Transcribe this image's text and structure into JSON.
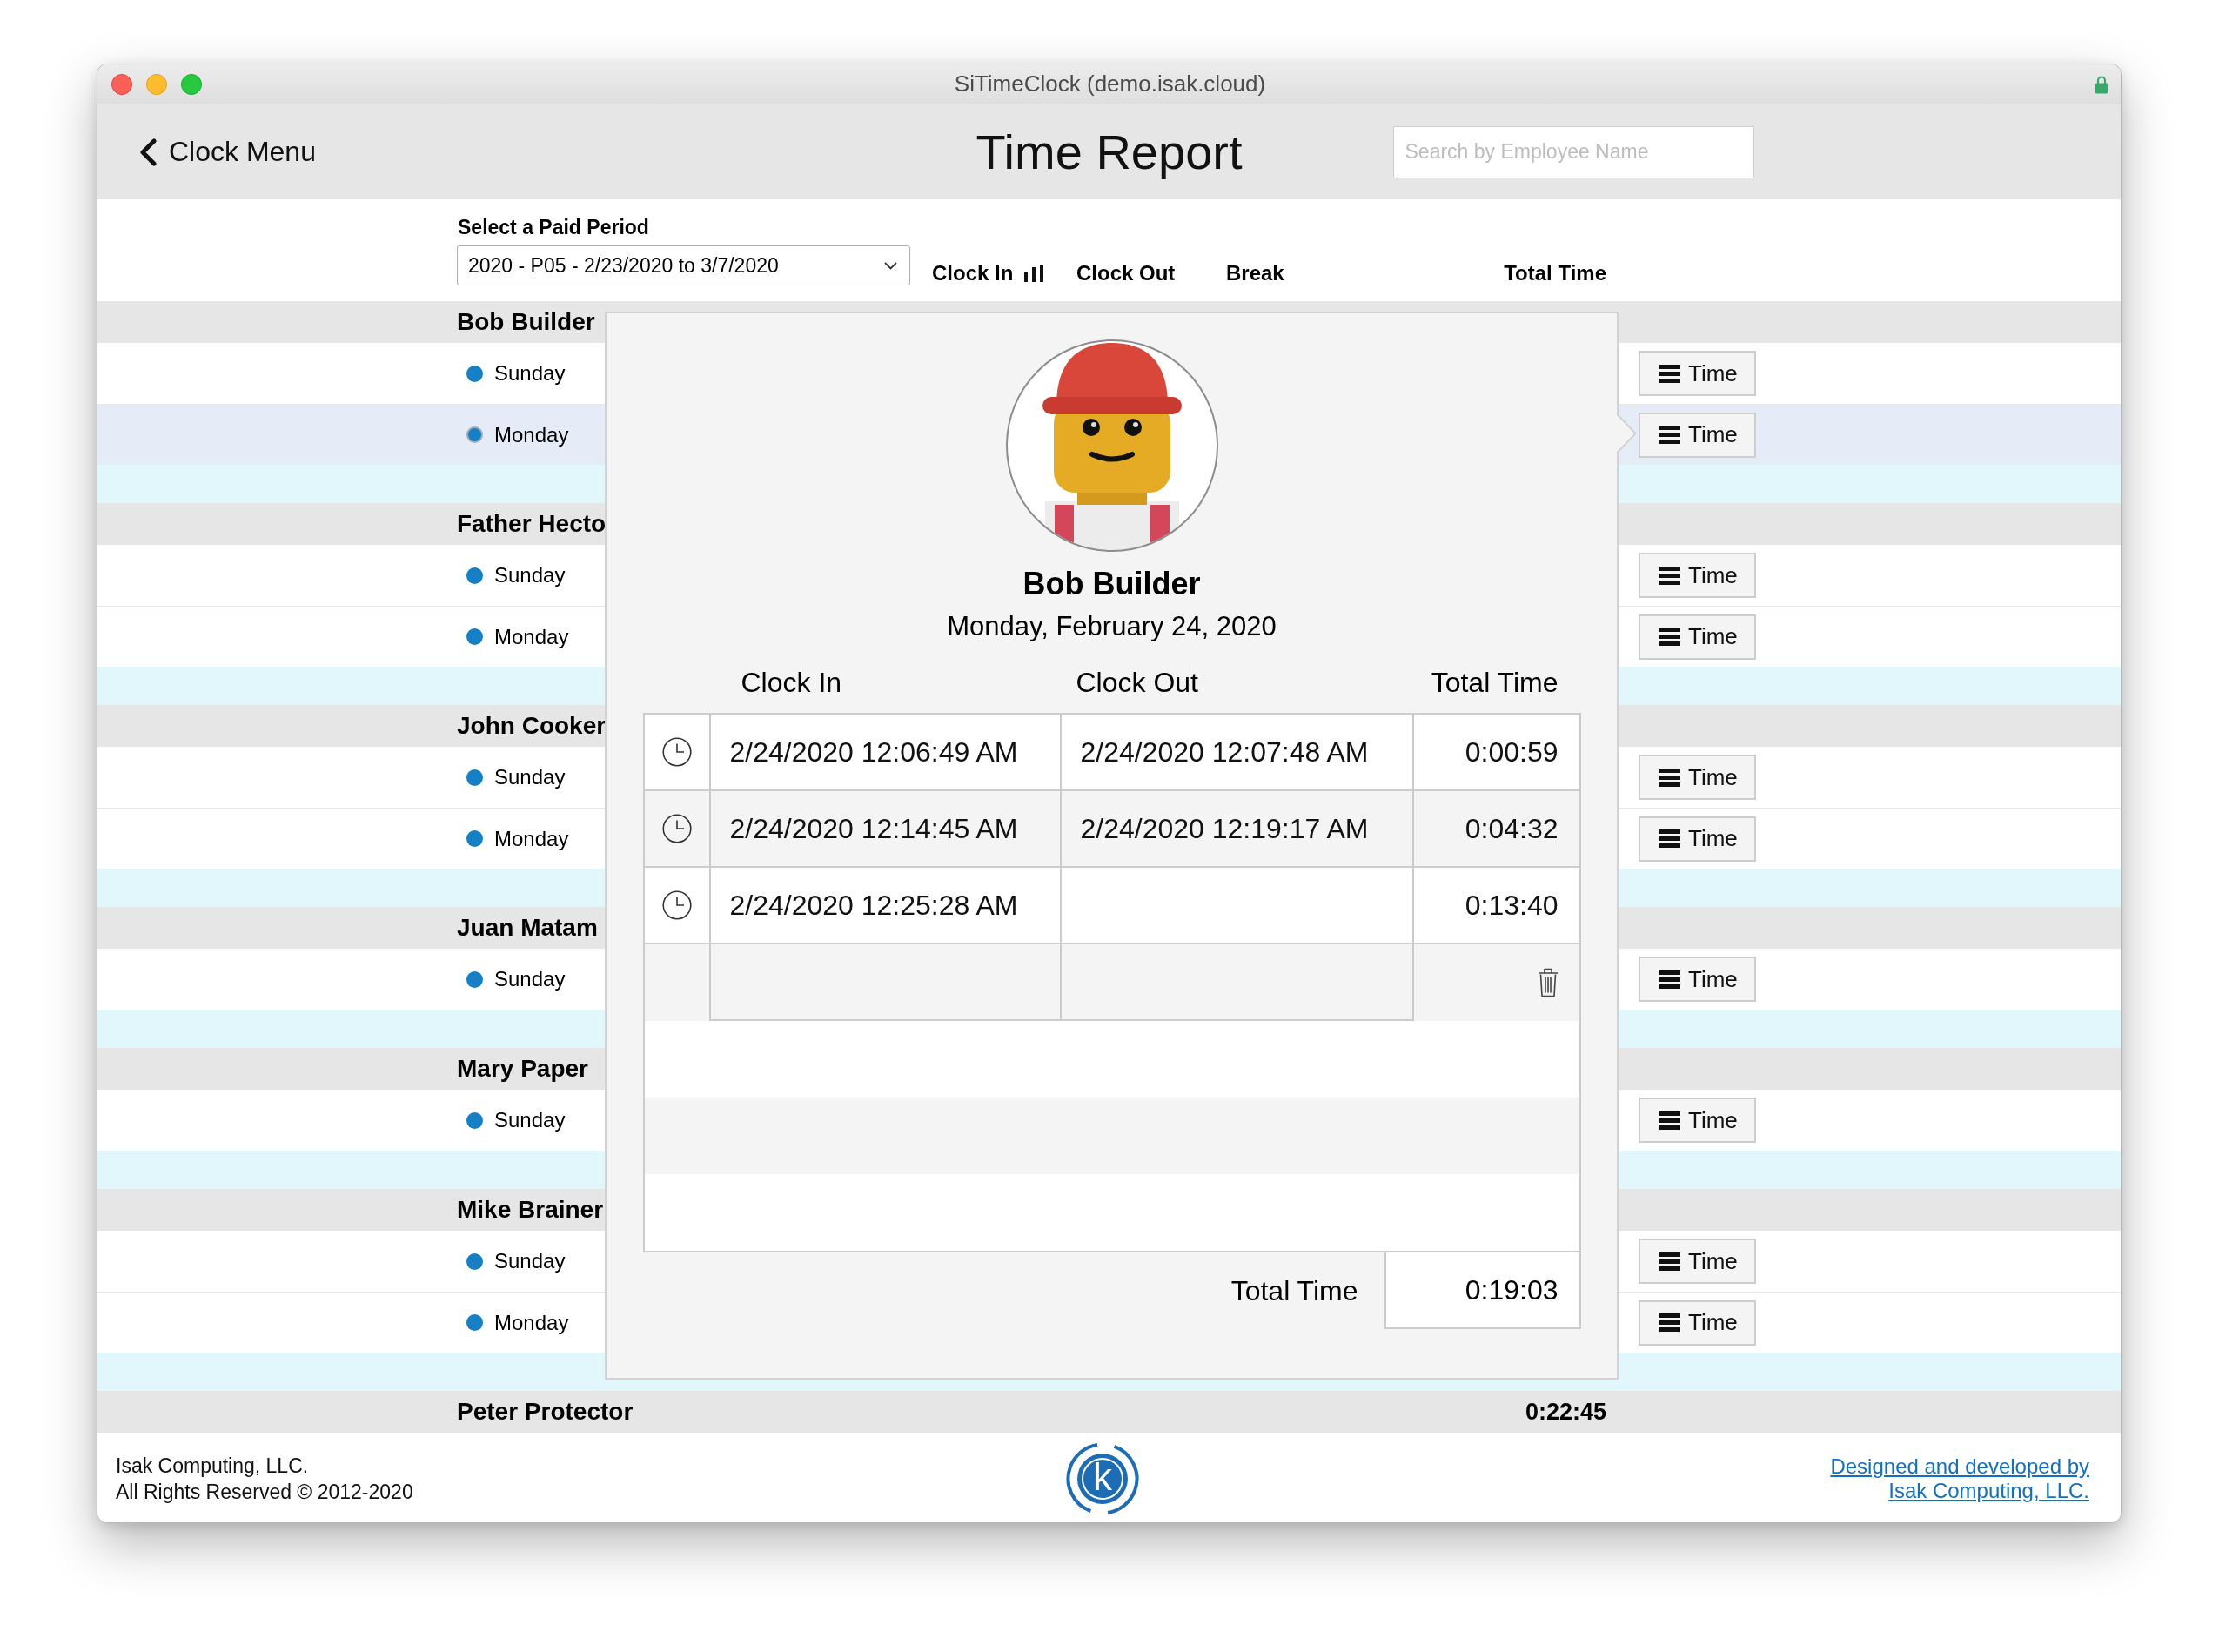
{
  "window": {
    "title": "SiTimeClock (demo.isak.cloud)"
  },
  "header": {
    "back": "Clock Menu",
    "title": "Time Report",
    "search": {
      "placeholder": "Search by Employee Name"
    }
  },
  "period": {
    "label": "Select a Paid Period",
    "value": "2020 - P05 - 2/23/2020 to 3/7/2020"
  },
  "columns": [
    {
      "label": "Clock In",
      "sorted": true
    },
    {
      "label": "Clock Out",
      "sorted": false
    },
    {
      "label": "Break",
      "sorted": false
    },
    {
      "label": "Total Time",
      "sorted": false
    }
  ],
  "employees": [
    {
      "name": "Bob Builder",
      "days": [
        {
          "label": "Sunday",
          "button": "Time",
          "selected": false
        },
        {
          "label": "Monday",
          "button": "Time",
          "selected": true
        }
      ]
    },
    {
      "name": "Father Hecto",
      "days": [
        {
          "label": "Sunday",
          "button": "Time",
          "selected": false
        },
        {
          "label": "Monday",
          "button": "Time",
          "selected": false
        }
      ]
    },
    {
      "name": "John Cooker",
      "days": [
        {
          "label": "Sunday",
          "button": "Time",
          "selected": false
        },
        {
          "label": "Monday",
          "button": "Time",
          "selected": false
        }
      ]
    },
    {
      "name": "Juan Matam",
      "days": [
        {
          "label": "Sunday",
          "button": "Time",
          "selected": false
        }
      ]
    },
    {
      "name": "Mary Paper",
      "days": [
        {
          "label": "Sunday",
          "button": "Time",
          "selected": false
        }
      ]
    },
    {
      "name": "Mike Brainer",
      "days": [
        {
          "label": "Sunday",
          "button": "Time",
          "selected": false
        },
        {
          "label": "Monday",
          "button": "Time",
          "selected": false
        }
      ]
    },
    {
      "name": "Peter Protector",
      "total": "0:22:45"
    }
  ],
  "popup": {
    "name": "Bob Builder",
    "date": "Monday, February 24, 2020",
    "columns": [
      "Clock In",
      "Clock Out",
      "Total Time"
    ],
    "entries": [
      {
        "kind": "entry",
        "clock_in": "2/24/2020 12:06:49 AM",
        "clock_out": "2/24/2020 12:07:48 AM",
        "total": "0:00:59"
      },
      {
        "kind": "entry",
        "clock_in": "2/24/2020 12:14:45 AM",
        "clock_out": "2/24/2020 12:19:17 AM",
        "total": "0:04:32"
      },
      {
        "kind": "entry",
        "clock_in": "2/24/2020 12:25:28 AM",
        "total": "0:13:40"
      },
      {
        "kind": "new"
      }
    ],
    "total_label": "Total Time",
    "total": "0:19:03"
  },
  "footer": {
    "company": "Isak Computing, LLC.",
    "rights": "All Rights Reserved © 2012-2020",
    "logo": "k",
    "credit": [
      "Designed and developed by",
      "Isak Computing, LLC."
    ]
  }
}
